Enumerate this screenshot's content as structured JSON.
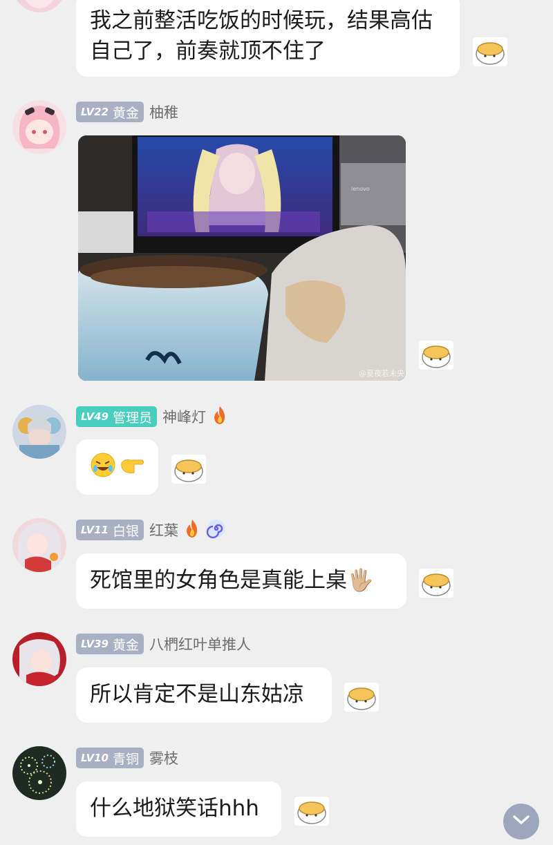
{
  "messages": [
    {
      "text": "我之前整活吃饭的时候玩，结果高估自己了，前奏就顶不住了"
    },
    {
      "level": "LV22",
      "title": "黄金",
      "username": "柚稚",
      "watermark": "@夏夜若未央",
      "screen_brand": "lenovo"
    },
    {
      "level": "LV49",
      "title": "管理员",
      "username": "神峰灯",
      "emojis": [
        "🤣",
        "👉"
      ]
    },
    {
      "level": "LV11",
      "title": "白银",
      "username": "红葉",
      "text": "死馆里的女角色是真能上桌",
      "hand_emoji": "🖐🏼"
    },
    {
      "level": "LV39",
      "title": "黄金",
      "username": "八椚红叶单推人",
      "text": "所以肯定不是山东姑凉"
    },
    {
      "level": "LV10",
      "title": "青铜",
      "username": "雾枝",
      "text": "什么地狱笑话hhh"
    }
  ],
  "colors": {
    "background": "#efeff0",
    "bubble": "#ffffff",
    "badge_gray": "#aab0c3",
    "badge_admin": "#49cdbf",
    "scroll_button": "#9ea6bd"
  },
  "icons": {
    "reaction": "hamster-sticker-icon",
    "fire": "fire-icon",
    "swirl": "swirl-icon",
    "scroll": "chevron-down-icon"
  }
}
